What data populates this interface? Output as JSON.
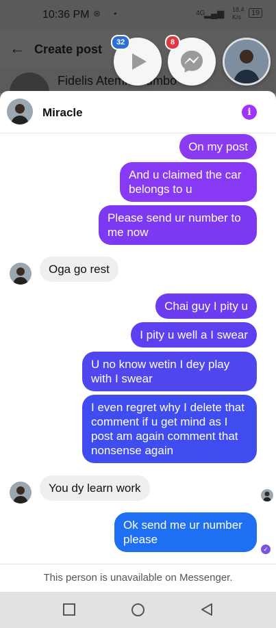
{
  "status_bar": {
    "time": "10:36 PM",
    "network": "4G",
    "speed_value": "18.4",
    "speed_unit": "K/s",
    "battery": "19"
  },
  "background_app": {
    "title": "Create post",
    "author_name": "Fidelis Atemie Sumbo"
  },
  "chat_heads": {
    "video_badge": "32",
    "messenger_badge": "8"
  },
  "chat": {
    "contact_name": "Miracle",
    "info_label": "i",
    "messages": [
      {
        "side": "out",
        "text": "On my post",
        "color": "#8a3bf2"
      },
      {
        "side": "out",
        "text": "And u claimed the car belongs to u",
        "color": "#8839f3"
      },
      {
        "side": "out",
        "text": "Please send ur number to me now",
        "color": "#7d38f1"
      },
      {
        "side": "in",
        "text": "Oga go rest"
      },
      {
        "side": "out",
        "text": "Chai guy I pity u",
        "color": "#6b3cf0"
      },
      {
        "side": "out",
        "text": "I pity u well a I swear",
        "color": "#5d40ef"
      },
      {
        "side": "out",
        "text": "U no know wetin I dey play with I swear",
        "color": "#4f46ee"
      },
      {
        "side": "out",
        "text": "I even regret why I delete that comment if u get mind as I post am again comment that nonsense again",
        "color": "#3f4df0"
      },
      {
        "side": "in",
        "text": "You dy learn work"
      },
      {
        "side": "out",
        "text": "Ok send me ur number please",
        "color": "#1e6ff2"
      }
    ],
    "footer_text": "This person is unavailable on Messenger."
  }
}
